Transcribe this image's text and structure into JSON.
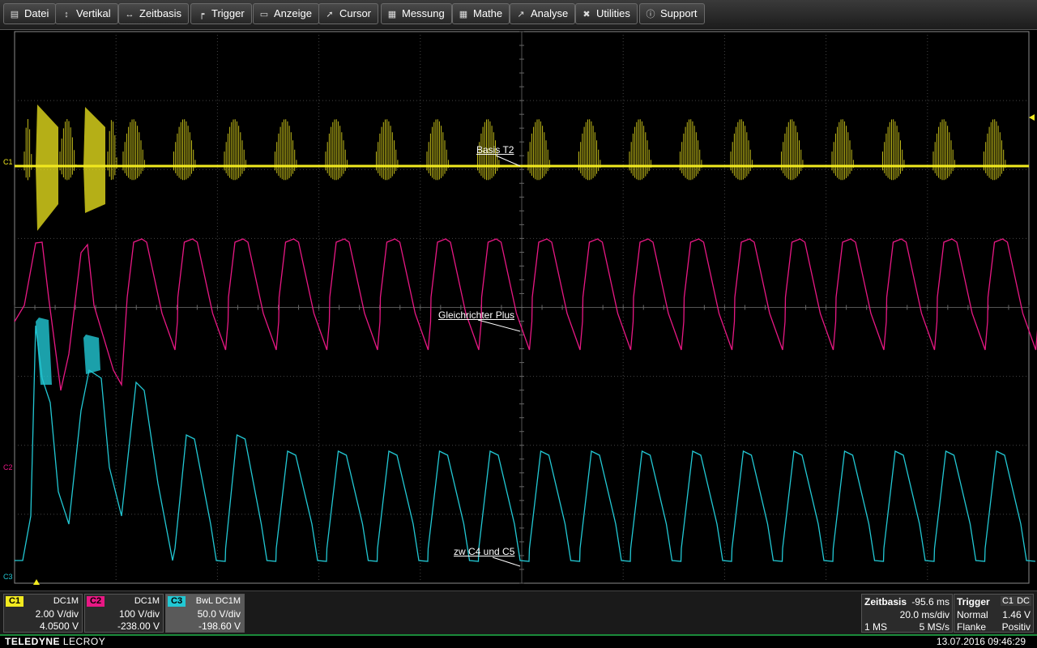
{
  "menu": [
    {
      "label": "Datei",
      "icon": "file-icon"
    },
    {
      "label": "Vertikal",
      "icon": "vertical-arrows-icon"
    },
    {
      "label": "Zeitbasis",
      "icon": "horizontal-arrows-icon"
    },
    {
      "label": "Trigger",
      "icon": "trigger-icon"
    },
    {
      "label": "Anzeige",
      "icon": "display-icon"
    },
    {
      "label": "Cursor",
      "icon": "cursor-icon"
    },
    {
      "label": "Messung",
      "icon": "measure-icon"
    },
    {
      "label": "Mathe",
      "icon": "math-icon"
    },
    {
      "label": "Analyse",
      "icon": "analysis-icon"
    },
    {
      "label": "Utilities",
      "icon": "wrench-icon"
    },
    {
      "label": "Support",
      "icon": "info-icon"
    }
  ],
  "traces": {
    "c1": {
      "marker": "C1",
      "label": "Basis T2",
      "color": "#f2ea1f"
    },
    "c2": {
      "marker": "C2",
      "label": "Gleichrichter Plus",
      "color": "#e81884"
    },
    "c3": {
      "marker": "C3",
      "label": "zw C4 und C5",
      "color": "#22c8d4"
    }
  },
  "channels": [
    {
      "tag": "C1",
      "color": "#f2ea1f",
      "coupling": "DC1M",
      "vdiv": "2.00 V/div",
      "offset": "4.0500 V"
    },
    {
      "tag": "C2",
      "color": "#e81884",
      "coupling": "DC1M",
      "vdiv": "100 V/div",
      "offset": "-238.00 V"
    },
    {
      "tag": "C3",
      "color": "#22c8d4",
      "coupling": "BwL DC1M",
      "vdiv": "50.0 V/div",
      "offset": "-198.60 V"
    }
  ],
  "timebase": {
    "title": "Zeitbasis",
    "delay": "-95.6 ms",
    "tdiv": "20.0 ms/div",
    "mem": "1 MS",
    "rate": "5 MS/s"
  },
  "trigger": {
    "title": "Trigger",
    "source": "C1",
    "coupling": "DC",
    "mode": "Normal",
    "level": "1.46 V",
    "type": "Flanke",
    "slope": "Positiv"
  },
  "footer": {
    "brand_bold": "TELEDYNE",
    "brand": "LECROY",
    "datetime": "13.07.2016 09:46:29"
  }
}
